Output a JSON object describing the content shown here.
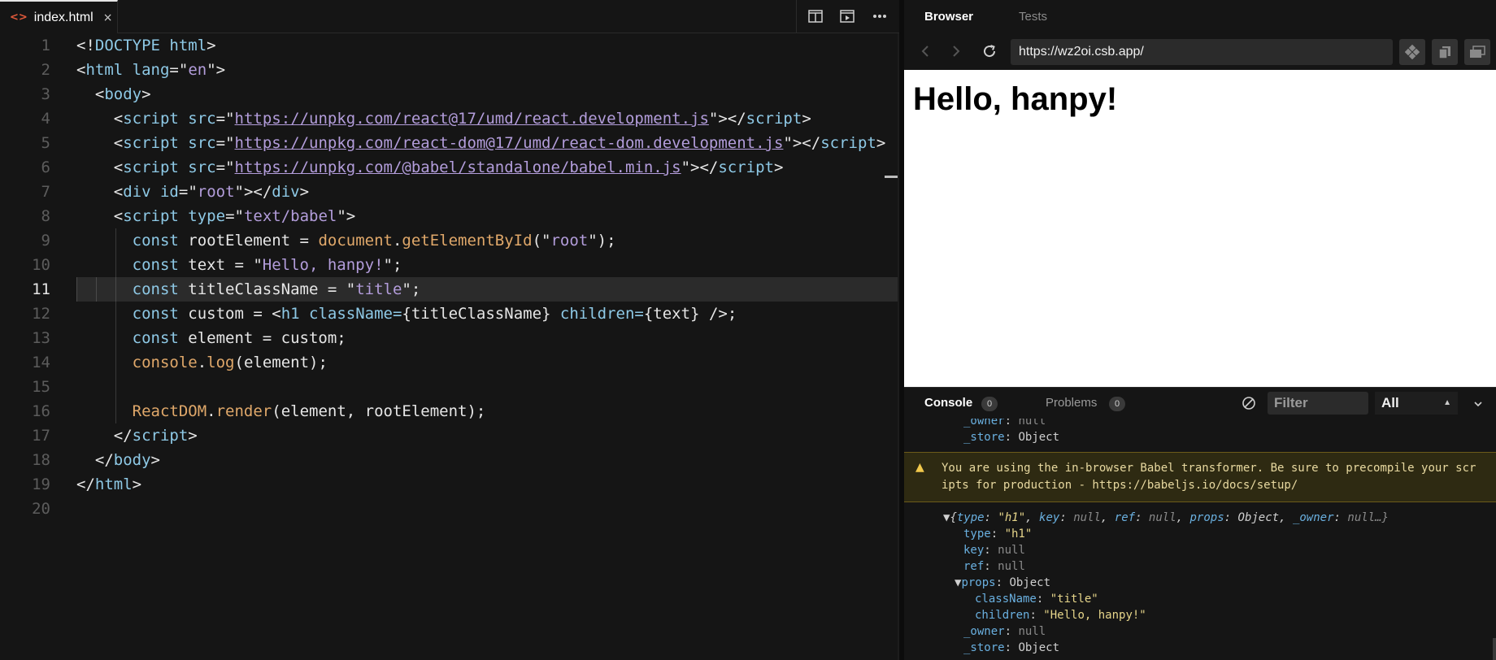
{
  "editor": {
    "tab": {
      "icon": "<>",
      "label": "index.html",
      "close": "×"
    },
    "lines": [
      "1",
      "2",
      "3",
      "4",
      "5",
      "6",
      "7",
      "8",
      "9",
      "10",
      "11",
      "12",
      "13",
      "14",
      "15",
      "16",
      "17",
      "18",
      "19",
      "20"
    ],
    "active_line": "11",
    "code": {
      "l1": {
        "a": "<!",
        "b": "DOCTYPE html",
        "c": ">"
      },
      "l2": {
        "a": "<",
        "b": "html",
        "c": " lang",
        "d": "=\"",
        "e": "en",
        "f": "\">"
      },
      "l3": {
        "a": "<",
        "b": "body",
        "c": ">"
      },
      "l4": {
        "a": "<",
        "b": "script",
        "c": " src",
        "d": "=\"",
        "e": "https://unpkg.com/react@17/umd/react.development.js",
        "f": "\"></",
        "g": "script",
        "h": ">"
      },
      "l5": {
        "a": "<",
        "b": "script",
        "c": " src",
        "d": "=\"",
        "e": "https://unpkg.com/react-dom@17/umd/react-dom.development.js",
        "f": "\"></",
        "g": "script",
        "h": ">"
      },
      "l6": {
        "a": "<",
        "b": "script",
        "c": " src",
        "d": "=\"",
        "e": "https://unpkg.com/@babel/standalone/babel.min.js",
        "f": "\"></",
        "g": "script",
        "h": ">"
      },
      "l7": {
        "a": "<",
        "b": "div",
        "c": " id",
        "d": "=\"",
        "e": "root",
        "f": "\"></",
        "g": "div",
        "h": ">"
      },
      "l8": {
        "a": "<",
        "b": "script",
        "c": " type",
        "d": "=\"",
        "e": "text/babel",
        "f": "\">"
      },
      "l9": {
        "kw": "const",
        "id": " rootElement = ",
        "obj": "document",
        "dot": ".",
        "fn": "getElementById",
        "p1": "(\"",
        "str": "root",
        "p2": "\");"
      },
      "l10": {
        "kw": "const",
        "id": " text = \"",
        "str": "Hello, hanpy!",
        "end": "\";"
      },
      "l11": {
        "kw": "const",
        "id": " titleClassName = \"",
        "str": "title",
        "end": "\";"
      },
      "l12": {
        "kw": "const",
        "id": " custom = <",
        "tag": "h1",
        "a1": " className",
        "eq1": "=",
        "v1": "{titleClassName}",
        "a2": " children",
        "eq2": "=",
        "v2": "{text}",
        "end": " />;"
      },
      "l13": {
        "kw": "const",
        "id": " element = custom;"
      },
      "l14": {
        "obj": "console",
        "dot": ".",
        "fn": "log",
        "rest": "(element);"
      },
      "l16": {
        "obj": "ReactDOM",
        "dot": ".",
        "fn": "render",
        "rest": "(element, rootElement);"
      },
      "l17": {
        "a": "</",
        "b": "script",
        "c": ">"
      },
      "l18": {
        "a": "</",
        "b": "body",
        "c": ">"
      },
      "l19": {
        "a": "</",
        "b": "html",
        "c": ">"
      }
    }
  },
  "browser": {
    "tabs": {
      "browser": "Browser",
      "tests": "Tests"
    },
    "url": "https://wz2oi.csb.app/",
    "preview_heading": "Hello, hanpy!"
  },
  "console": {
    "tabs": {
      "console": "Console",
      "console_count": "0",
      "problems": "Problems",
      "problems_count": "0"
    },
    "filter_placeholder": "Filter",
    "level": "All",
    "top_rows": {
      "owner_key": "_owner",
      "owner_val": "null",
      "store_key": "_store",
      "store_val": "Object"
    },
    "warning": "You are using the in-browser Babel transformer. Be sure to precompile your scripts for production - https://babeljs.io/docs/setup/",
    "object_summary": {
      "open": "{",
      "type_k": "type",
      "type_v": "\"h1\"",
      "key_k": "key",
      "key_v": "null",
      "ref_k": "ref",
      "ref_v": "null",
      "props_k": "props",
      "props_v": "Object",
      "owner_k": "_owner",
      "owner_v": "null…}"
    },
    "props": {
      "type_k": "type",
      "type_v": "\"h1\"",
      "key_k": "key",
      "key_v": "null",
      "ref_k": "ref",
      "ref_v": "null",
      "props_k": "props",
      "props_v": "Object",
      "class_k": "className",
      "class_v": "\"title\"",
      "children_k": "children",
      "children_v": "\"Hello, hanpy!\"",
      "owner_k": "_owner",
      "owner_v": "null",
      "store_k": "_store",
      "store_v": "Object"
    }
  },
  "colors": {
    "accent_tab_icon": "#e1593a",
    "warning_bg": "#2e2a12",
    "warning_icon": "#f2c94c"
  },
  "icons": [
    "html-file-icon",
    "close-icon",
    "split-editor-icon",
    "preview-icon",
    "more-icon",
    "back-icon",
    "forward-icon",
    "refresh-icon",
    "devtools-icon",
    "open-window-icon",
    "layout-icon",
    "clear-console-icon",
    "chevron-down-icon",
    "warning-icon",
    "triangle-expand-icon"
  ]
}
